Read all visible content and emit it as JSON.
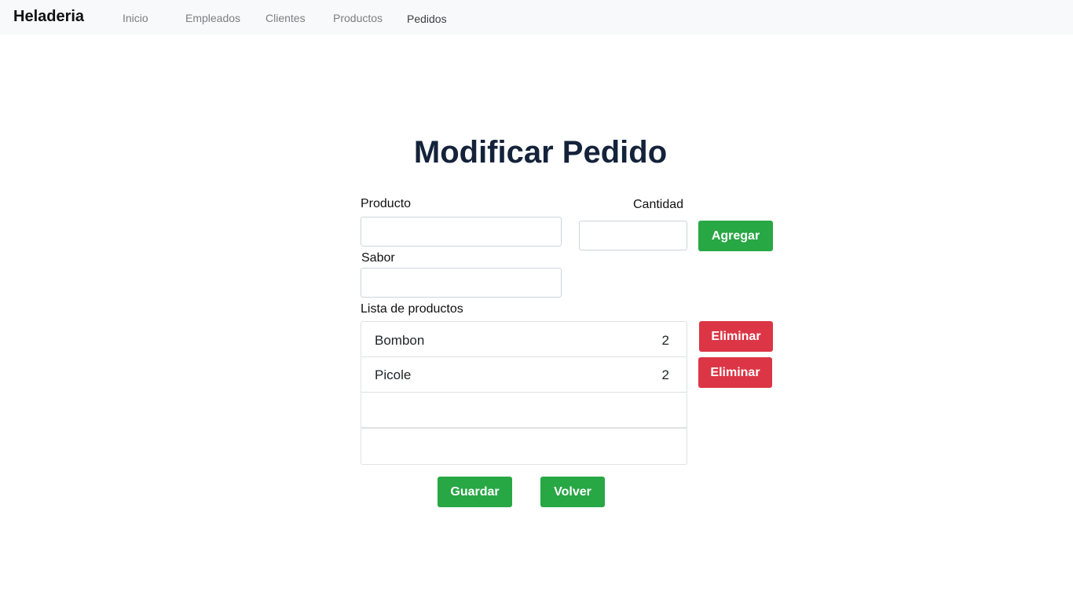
{
  "navbar": {
    "brand": "Heladeria",
    "links": [
      {
        "label": "Inicio"
      },
      {
        "label": "Empleados"
      },
      {
        "label": "Clientes"
      },
      {
        "label": "Productos"
      },
      {
        "label": "Pedidos"
      }
    ]
  },
  "main": {
    "title": "Modificar Pedido",
    "form": {
      "producto_label": "Producto",
      "producto_value": "",
      "cantidad_label": "Cantidad",
      "cantidad_value": "",
      "sabor_label": "Sabor",
      "sabor_value": "",
      "agregar_label": "Agregar"
    },
    "list": {
      "label": "Lista de productos",
      "items": [
        {
          "name": "Bombon",
          "qty": "2"
        },
        {
          "name": "Picole",
          "qty": "2"
        }
      ],
      "delete_label": "Eliminar"
    },
    "actions": {
      "guardar_label": "Guardar",
      "volver_label": "Volver"
    }
  },
  "colors": {
    "success": "#28a745",
    "danger": "#dc3545",
    "title": "#14233a",
    "navbar_bg": "#f8f9fa"
  }
}
